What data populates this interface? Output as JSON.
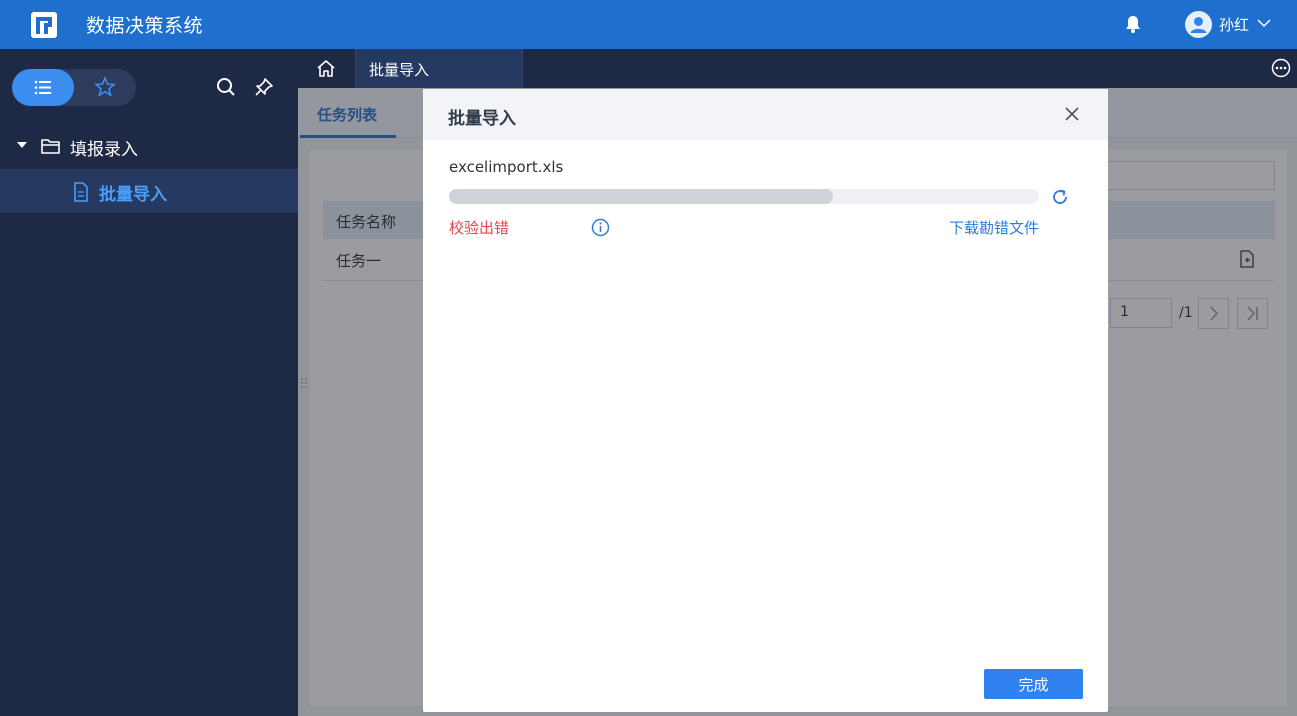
{
  "app": {
    "title": "数据决策系统"
  },
  "user": {
    "name": "孙红"
  },
  "sidebar": {
    "folder_label": "填报录入",
    "item_label": "批量导入"
  },
  "tabbar": {
    "active_tab": "批量导入"
  },
  "page": {
    "subtab": "任务列表",
    "table": {
      "header": "任务名称",
      "rows": [
        "任务一"
      ]
    },
    "pagination": {
      "current": "1",
      "total": "/1"
    }
  },
  "modal": {
    "title": "批量导入",
    "file_name": "excelimport.xls",
    "progress": 0.65,
    "status": "校验出错",
    "download_label": "下载勘错文件",
    "done_label": "完成"
  },
  "colors": {
    "topbar": "#1f6fcf",
    "sidebar": "#1e2a45",
    "accent": "#2f82f0",
    "error": "#e8444f",
    "link": "#2b7de0"
  }
}
